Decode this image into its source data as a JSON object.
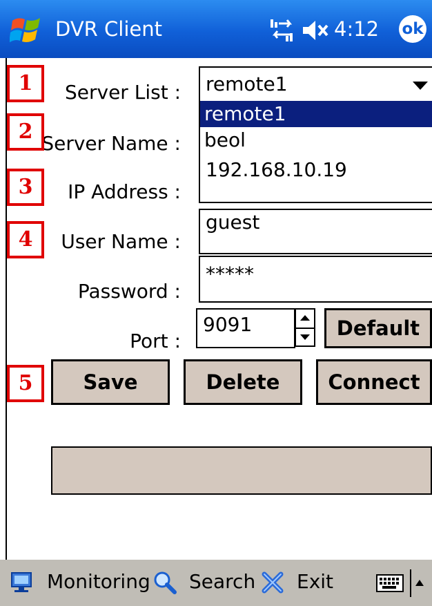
{
  "titlebar": {
    "title": "DVR Client",
    "time": "4:12",
    "ok_label": "ok"
  },
  "form": {
    "server_list": {
      "label": "Server List :",
      "value": "remote1",
      "options": [
        "remote1",
        "beol"
      ]
    },
    "server_name": {
      "label": "Server Name :"
    },
    "ip_address": {
      "label": "IP Address :",
      "value": "192.168.10.19"
    },
    "user_name": {
      "label": "User Name :",
      "value": "guest"
    },
    "password": {
      "label": "Password :",
      "value": "*****"
    },
    "port": {
      "label": "Port :",
      "value": "9091"
    },
    "default_label": "Default"
  },
  "buttons": {
    "save": "Save",
    "delete": "Delete",
    "connect": "Connect"
  },
  "callouts": [
    "1",
    "2",
    "3",
    "4",
    "5"
  ],
  "bottombar": {
    "monitoring": "Monitoring",
    "search": "Search",
    "exit": "Exit"
  },
  "colors": {
    "titlebar": "#1060d8",
    "selection": "#0b1f7e",
    "button_face": "#d4c8be",
    "callout": "#e00000",
    "taskbar": "#c0bdb6"
  }
}
